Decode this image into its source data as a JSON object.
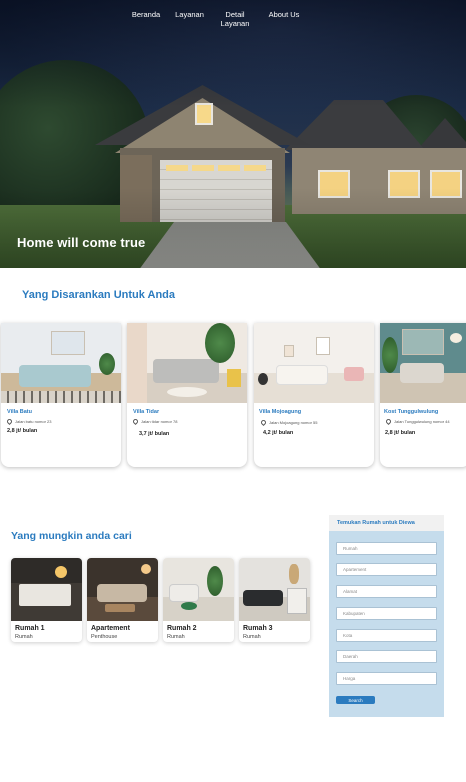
{
  "nav": {
    "items": [
      "Beranda",
      "Layanan",
      "Detail Layanan",
      "About Us"
    ]
  },
  "hero": {
    "title": "Home will come true"
  },
  "recommended": {
    "title": "Yang Disarankan Untuk Anda",
    "cards": [
      {
        "name": "Villa Batu",
        "address": "Jalan batu nomor 23",
        "price": "2,8 jt/ bulan"
      },
      {
        "name": "Villa Tidar",
        "address": "Jalan tidar nomor 78",
        "price": "3,7 jt/ bulan"
      },
      {
        "name": "Villa Mojoagung",
        "address": "Jalan Mojoagung nomor 55",
        "price": "4,2 jt/ bulan"
      },
      {
        "name": "Kost Tunggulwulung",
        "address": "Jalan Tunggulwulung nomor 44",
        "price": "2,8 jt/ bulan"
      }
    ]
  },
  "maybe": {
    "title": "Yang mungkin anda cari",
    "cards": [
      {
        "title": "Rumah 1",
        "subtitle": "Rumah"
      },
      {
        "title": "Apartement",
        "subtitle": "Penthouse"
      },
      {
        "title": "Rumah 2",
        "subtitle": "Rumah"
      },
      {
        "title": "Rumah 3",
        "subtitle": "Rumah"
      }
    ]
  },
  "search": {
    "title": "Temukan Rumah untuk Diewa",
    "placeholders": [
      "Rumah",
      "Apartement",
      "Alamat",
      "Kabupaten",
      "Kota",
      "Daerah",
      "Harga"
    ],
    "button": "Search"
  },
  "colors": {
    "accent": "#2b7bbf",
    "panel": "#c5dcec"
  }
}
